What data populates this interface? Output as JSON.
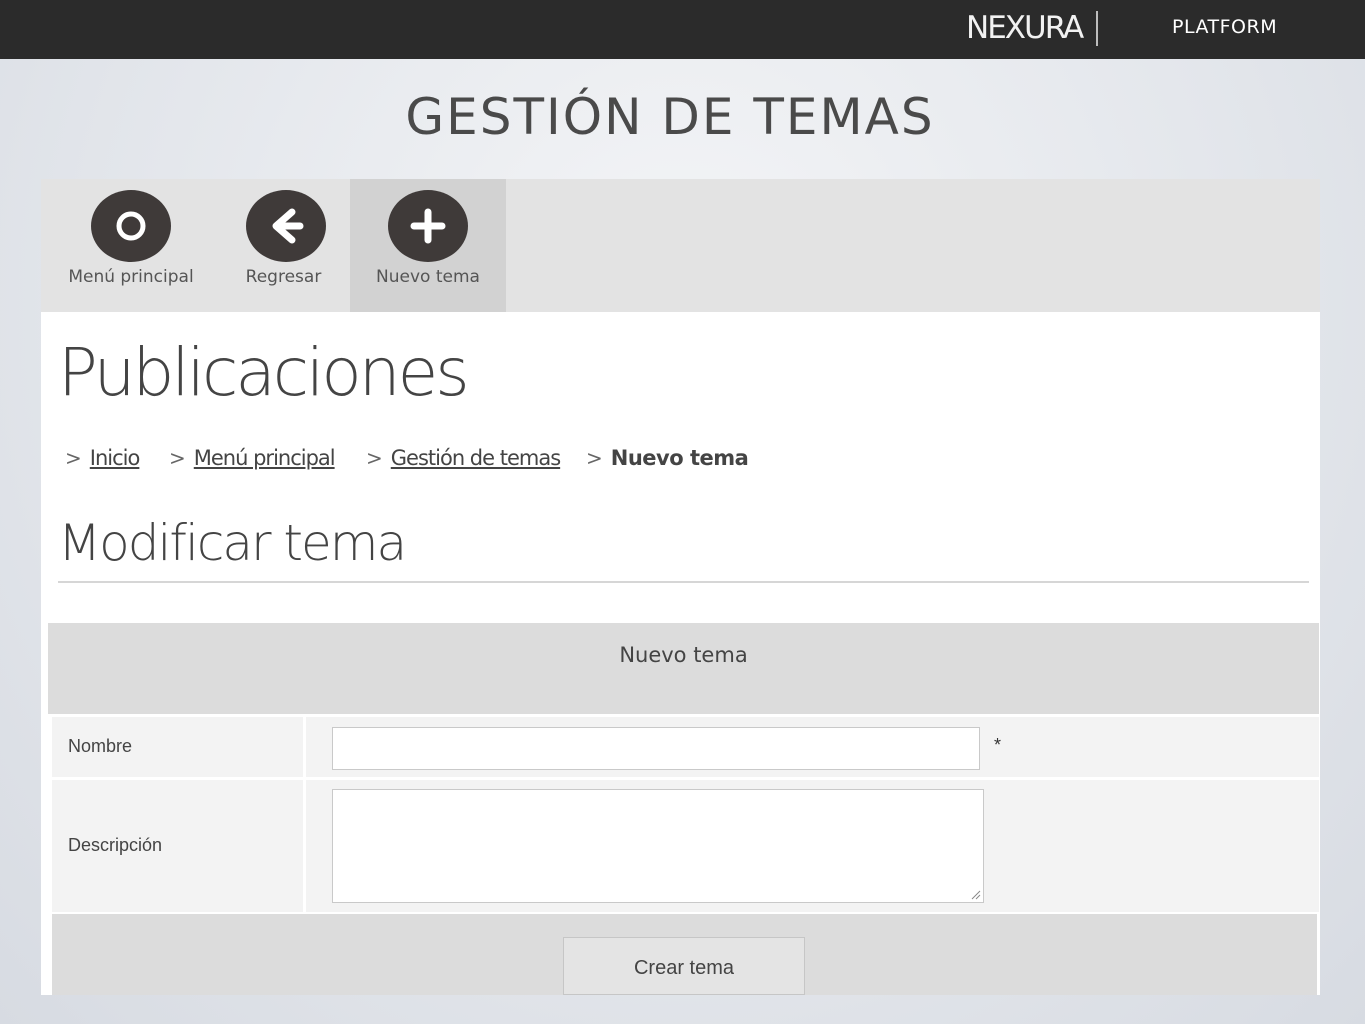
{
  "topbar": {
    "brand": "NEXURA",
    "platform": "PLATFORM"
  },
  "slide_title": "GESTIÓN DE TEMAS",
  "toolbar": {
    "items": [
      {
        "label": "Menú principal",
        "icon": "circle-ring-icon"
      },
      {
        "label": "Regresar",
        "icon": "arrow-left-icon"
      },
      {
        "label": "Nuevo tema",
        "icon": "plus-icon",
        "active": true
      }
    ]
  },
  "page_heading": "Publicaciones",
  "breadcrumb": [
    {
      "label": "Inicio",
      "link": true
    },
    {
      "label": "Menú principal",
      "link": true
    },
    {
      "label": "Gestión de temas",
      "link": true
    },
    {
      "label": "Nuevo tema",
      "link": false
    }
  ],
  "section_title": "Modificar tema",
  "form": {
    "header": "Nuevo tema",
    "fields": {
      "nombre": {
        "label": "Nombre",
        "value": "",
        "required_mark": "*"
      },
      "descripcion": {
        "label": "Descripción",
        "value": ""
      }
    },
    "submit_label": "Crear tema"
  },
  "colors": {
    "topbar_bg": "#2b2b2b",
    "toolbar_bg": "#e3e3e3",
    "toolbar_active_bg": "#d2d2d2",
    "tool_icon_bg": "#3f3a39",
    "form_header_bg": "#dcdcdc"
  }
}
